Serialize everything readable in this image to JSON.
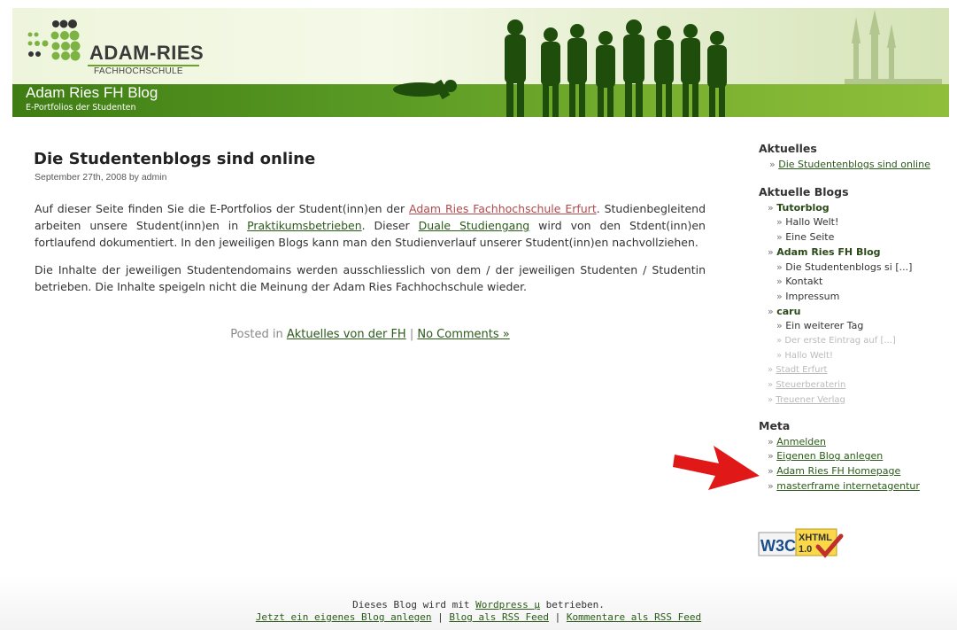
{
  "header": {
    "logo_name": "ADAM-RIES",
    "logo_sub": "FACHHOCHSCHULE",
    "blog_title": "Adam Ries FH Blog",
    "tagline": "E-Portfolios der Studenten"
  },
  "post": {
    "title": "Die Studentenblogs sind online",
    "meta": "September 27th, 2008 by admin",
    "p1_a": "Auf dieser Seite finden Sie die E-Portfolios der Student(inn)en der ",
    "p1_link1": "Adam Ries Fachhochschule Erfurt",
    "p1_b": ". Studienbegleitend arbeiten unsere Student(inn)en in ",
    "p1_link2": "Praktikumsbetrieben",
    "p1_c": ". Dieser ",
    "p1_link3": "Duale Studiengang",
    "p1_d": " wird von den Stdent(inn)en fortlaufend dokumentiert. In den jeweiligen Blogs kann man den Studienverlauf unserer Student(inn)en nachvollziehen.",
    "p2": "Die Inhalte der jeweiligen Studentendomains werden ausschliesslich von dem / der jeweiligen Studenten / Studentin betrieben. Die Inhalte speigeln nicht die Meinung der Adam Ries Fachhochschule wieder.",
    "posted_in": "Posted in ",
    "category_link": "Aktuelles von der FH",
    "separator": " | ",
    "comments_link": "No Comments »"
  },
  "sidebar": {
    "bullet": "»",
    "aktuelles_heading": "Aktuelles",
    "aktuelles_item": "Die Studentenblogs sind online",
    "blogs_heading": "Aktuelle Blogs",
    "blog1": "Tutorblog",
    "blog1_posts": [
      "Hallo Welt!",
      "Eine Seite"
    ],
    "blog2": "Adam Ries FH Blog",
    "blog2_posts": [
      "Die Studentenblogs si [...]",
      "Kontakt",
      "Impressum"
    ],
    "blog3": "caru",
    "blog3_posts": [
      "Ein weiterer Tag",
      "Der erste Eintrag auf [...]",
      "Hallo Welt!"
    ],
    "faded_blogs": [
      "Stadt Erfurt",
      "Steuerberaterin",
      "Treuener Verlag"
    ],
    "meta_heading": "Meta",
    "meta_items": [
      "Anmelden",
      "Eigenen Blog anlegen",
      "Adam Ries FH Homepage",
      "masterframe internetagentur"
    ]
  },
  "badge": {
    "w3c": "W3C",
    "xhtml": "XHTML",
    "version": "1.0"
  },
  "footer": {
    "line1_a": "Dieses Blog wird mit ",
    "wordpress_link": "Wordpress µ",
    "line1_b": " betrieben.",
    "link1": "Jetzt ein eigenes Blog anlegen",
    "sep": " | ",
    "link2": "Blog als RSS Feed",
    "link3": "Kommentare als RSS Feed"
  },
  "colors": {
    "header_green": "#5a9a24",
    "link_green": "#2a5a18",
    "arrow_red": "#e01818"
  }
}
